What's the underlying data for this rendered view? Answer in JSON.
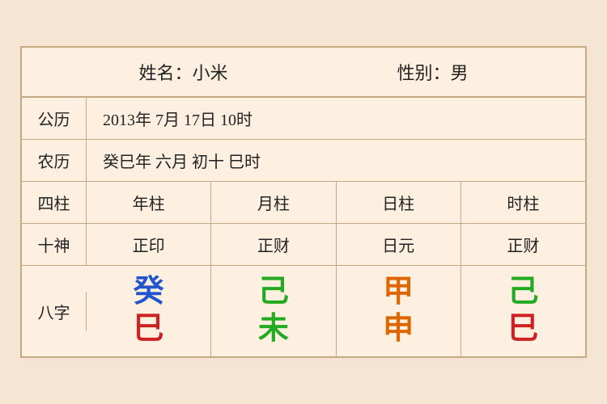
{
  "header": {
    "name_label": "姓名：小米",
    "gender_label": "性别：男"
  },
  "solar": {
    "label": "公历",
    "value": "2013年 7月 17日 10时"
  },
  "lunar": {
    "label": "农历",
    "value": "癸巳年 六月 初十 巳时"
  },
  "columns": {
    "label": "四柱",
    "year": "年柱",
    "month": "月柱",
    "day": "日柱",
    "hour": "时柱"
  },
  "shishen": {
    "label": "十神",
    "year": "正印",
    "month": "正财",
    "day": "日元",
    "hour": "正财"
  },
  "bazhi": {
    "label": "八字",
    "year_top": "癸",
    "year_top_color": "blue",
    "year_bottom": "巳",
    "year_bottom_color": "red",
    "month_top": "己",
    "month_top_color": "green",
    "month_bottom": "未",
    "month_bottom_color": "green",
    "day_top": "甲",
    "day_top_color": "orange",
    "day_bottom": "申",
    "day_bottom_color": "orange",
    "hour_top": "己",
    "hour_top_color": "green",
    "hour_bottom": "巳",
    "hour_bottom_color": "red"
  }
}
